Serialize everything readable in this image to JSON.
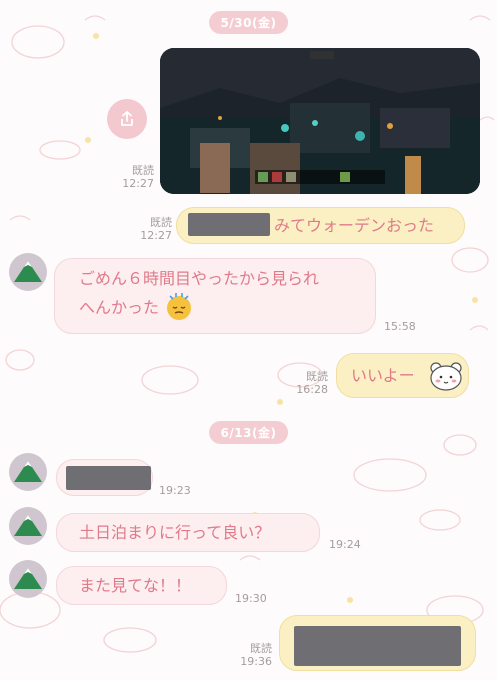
{
  "colors": {
    "date_pill": "#f4cdd2",
    "bubble_out": "#fbf0c4",
    "bubble_in": "#fdeef0",
    "text": "#e07a8a",
    "meta": "#a49c9e"
  },
  "dates": [
    "5/30(金)",
    "6/13(金)"
  ],
  "messages": {
    "m1": {
      "read": "既読",
      "time": "12:27"
    },
    "m2": {
      "read": "既読",
      "time": "12:27",
      "text": "みてウォーデンおった"
    },
    "m3": {
      "time": "15:58",
      "line1": "ごめん６時間目やったから見られ",
      "line2": "へんかった"
    },
    "m4": {
      "read": "既読",
      "time": "16:28",
      "text": "いいよー"
    },
    "m5": {
      "time": "19:23"
    },
    "m6": {
      "time": "19:24",
      "text": "土日泊まりに行って良い？"
    },
    "m7": {
      "time": "19:30",
      "text": "また見てな！！"
    },
    "m8": {
      "read": "既読",
      "time": "19:36"
    }
  },
  "icons": {
    "share": "share-icon",
    "avatar": "mountain-avatar-icon",
    "emoji_face": "sleepy-face-emoji",
    "sticker": "bear-face-sticker"
  }
}
